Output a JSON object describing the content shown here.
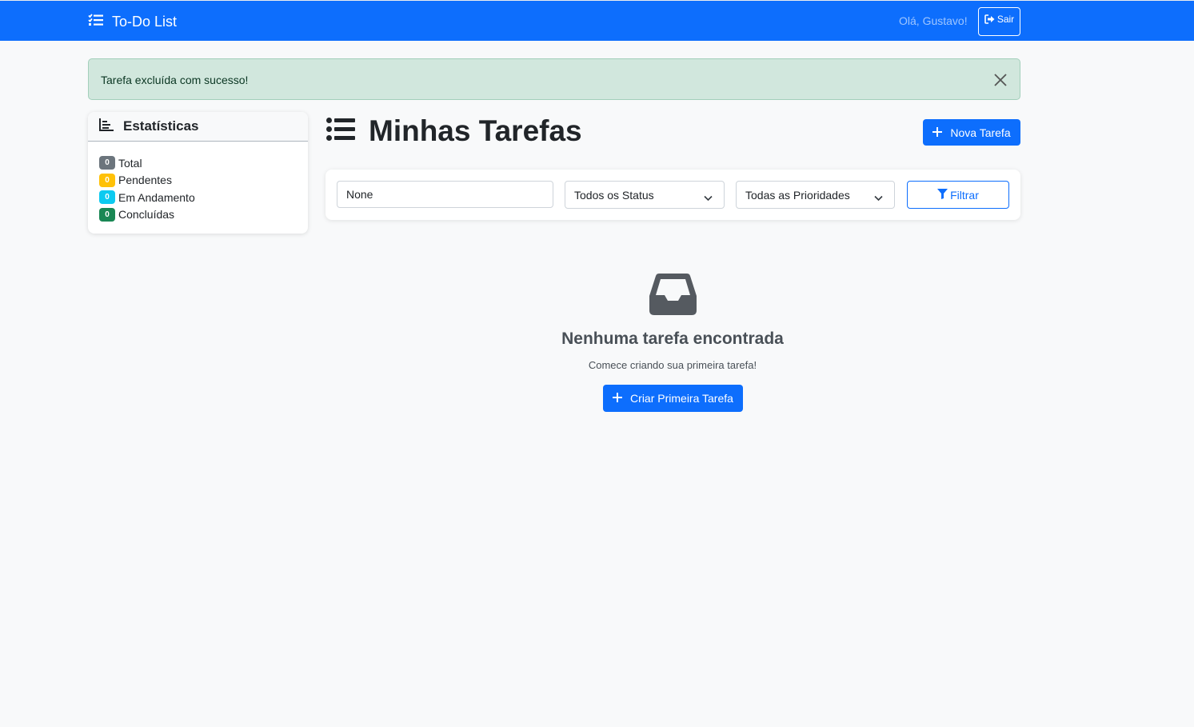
{
  "navbar": {
    "brand": "To-Do List",
    "greeting": "Olá, Gustavo!",
    "logout_label": "Sair",
    "color": "#0d6efd"
  },
  "alert": {
    "message": "Tarefa excluída com sucesso!",
    "type": "success"
  },
  "stats": {
    "title": "Estatísticas",
    "items": [
      {
        "count": "0",
        "label": "Total",
        "color": "#6c757d"
      },
      {
        "count": "0",
        "label": "Pendentes",
        "color": "#ffc107"
      },
      {
        "count": "0",
        "label": "Em Andamento",
        "color": "#0dcaf0"
      },
      {
        "count": "0",
        "label": "Concluídas",
        "color": "#198754"
      }
    ]
  },
  "main": {
    "title": "Minhas Tarefas",
    "new_task_label": "Nova Tarefa"
  },
  "filters": {
    "search_value": "None",
    "status_selected": "Todos os Status",
    "priority_selected": "Todas as Prioridades",
    "filter_label": "Filtrar"
  },
  "empty": {
    "title": "Nenhuma tarefa encontrada",
    "subtitle": "Comece criando sua primeira tarefa!",
    "cta_label": "Criar Primeira Tarefa",
    "icon": "inbox-icon"
  }
}
